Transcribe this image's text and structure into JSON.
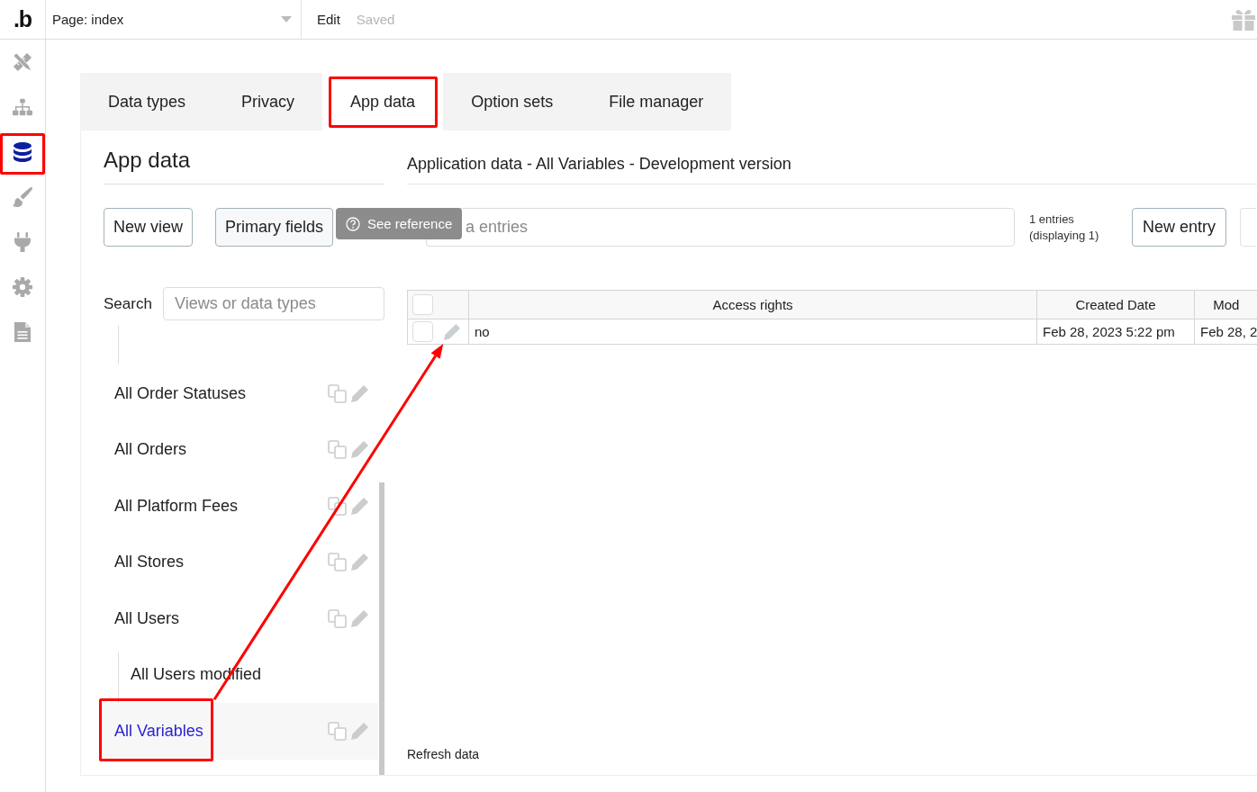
{
  "top_bar": {
    "logo": ".b",
    "page_selector": "Page: index",
    "menu": "Edit",
    "status": "Saved"
  },
  "sidebar": {
    "items": [
      {
        "kind": "design",
        "selected": false,
        "highlighted": false
      },
      {
        "kind": "workflow",
        "selected": false,
        "highlighted": false
      },
      {
        "kind": "data",
        "selected": true,
        "highlighted": true
      },
      {
        "kind": "styles",
        "selected": false,
        "highlighted": false
      },
      {
        "kind": "plugins",
        "selected": false,
        "highlighted": false
      },
      {
        "kind": "settings",
        "selected": false,
        "highlighted": false
      },
      {
        "kind": "logs",
        "selected": false,
        "highlighted": false
      }
    ]
  },
  "tabs": [
    {
      "label": "Data types",
      "selected": false,
      "highlighted": false
    },
    {
      "label": "Privacy",
      "selected": false,
      "highlighted": false
    },
    {
      "label": "App data",
      "selected": true,
      "highlighted": true
    },
    {
      "label": "Option sets",
      "selected": false,
      "highlighted": false
    },
    {
      "label": "File manager",
      "selected": false,
      "highlighted": false
    }
  ],
  "left_panel": {
    "title": "App data",
    "buttons": [
      "New view",
      "Primary fields"
    ],
    "tooltip": "See reference",
    "search": {
      "label": "Search",
      "placeholder": "Views or data types"
    },
    "views": [
      {
        "label": "All Order Statuses",
        "selected": false,
        "highlighted": false
      },
      {
        "label": "All Orders",
        "selected": false,
        "highlighted": false
      },
      {
        "label": "All Platform Fees",
        "selected": false,
        "highlighted": false
      },
      {
        "label": "All Stores",
        "selected": false,
        "highlighted": false
      },
      {
        "label": "All Users",
        "selected": false,
        "highlighted": false,
        "children": [
          {
            "label": "All Users modified",
            "selected": false,
            "highlighted": false
          }
        ]
      },
      {
        "label": "All Variables",
        "selected": true,
        "highlighted": true
      }
    ]
  },
  "right_panel": {
    "title": "Application data - All Variables - Development version",
    "search": {
      "placeholder": "a entries"
    },
    "count": "1 entries (displaying 1)",
    "buttons": [
      {
        "label": "New entry",
        "disabled": false
      },
      {
        "disabled": true
      }
    ],
    "table": {
      "select_all_checked": false,
      "columns": [
        "Access rights",
        "Created Date",
        "Mod"
      ],
      "rows": [
        {
          "checked": false,
          "cells": [
            "no",
            "Feb 28, 2023 5:22 pm",
            "Feb 28, 2"
          ]
        }
      ]
    },
    "refresh": "Refresh data"
  },
  "annotation_arrow": true
}
